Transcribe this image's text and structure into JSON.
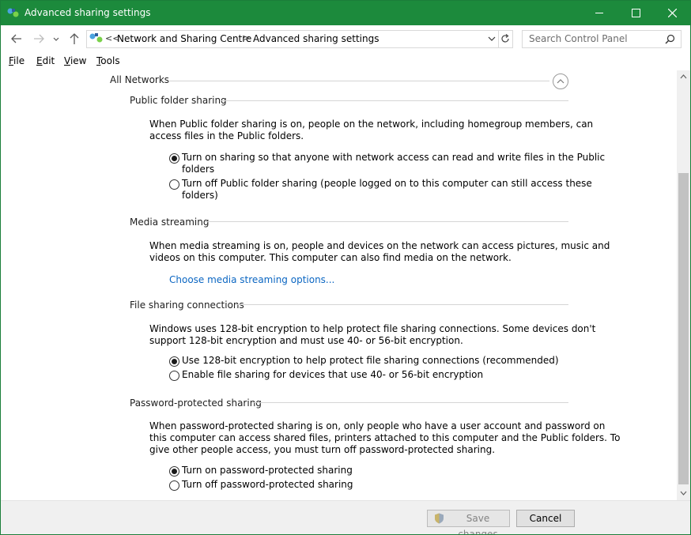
{
  "window": {
    "title": "Advanced sharing settings"
  },
  "address": {
    "overflow": "<<",
    "breadcrumb": [
      "Network and Sharing Centre",
      "Advanced sharing settings"
    ],
    "separator": ">"
  },
  "search": {
    "placeholder": "Search Control Panel"
  },
  "menu": {
    "items": [
      {
        "label": "File",
        "accel": "F",
        "rest": "ile"
      },
      {
        "label": "Edit",
        "accel": "E",
        "rest": "dit"
      },
      {
        "label": "View",
        "accel": "V",
        "rest": "iew"
      },
      {
        "label": "Tools",
        "accel": "T",
        "rest": "ools"
      }
    ]
  },
  "content": {
    "section_title": "All Networks",
    "public_folder": {
      "heading": "Public folder sharing",
      "desc_line1": "When Public folder sharing is on, people on the network, including homegroup members, can",
      "desc_line2": "access files in the Public folders.",
      "opt_on_line1": "Turn on sharing so that anyone with network access can read and write files in the Public",
      "opt_on_line2": "folders",
      "opt_off_line1": "Turn off Public folder sharing (people logged on to this computer can still access these",
      "opt_off_line2": "folders)",
      "selected": "on"
    },
    "media": {
      "heading": "Media streaming",
      "desc_line1": "When media streaming is on, people and devices on the network can access pictures, music and",
      "desc_line2": "videos on this computer. This computer can also find media on the network.",
      "link": "Choose media streaming options..."
    },
    "file_sharing": {
      "heading": "File sharing connections",
      "desc_line1": "Windows uses 128-bit encryption to help protect file sharing connections. Some devices don't",
      "desc_line2": "support 128-bit encryption and must use 40- or 56-bit encryption.",
      "opt_128": "Use 128-bit encryption to help protect file sharing connections (recommended)",
      "opt_40": "Enable file sharing for devices that use 40- or 56-bit encryption",
      "selected": "128"
    },
    "password": {
      "heading": "Password-protected sharing",
      "desc_line1": "When password-protected sharing is on, only people who have a user account and password on",
      "desc_line2": "this computer can access shared files, printers attached to this computer and the Public folders. To",
      "desc_line3": "give other people access, you must turn off password-protected sharing.",
      "opt_on": "Turn on password-protected sharing",
      "opt_off": "Turn off password-protected sharing",
      "selected": "on"
    }
  },
  "footer": {
    "save_label": "Save changes",
    "cancel_label": "Cancel"
  }
}
